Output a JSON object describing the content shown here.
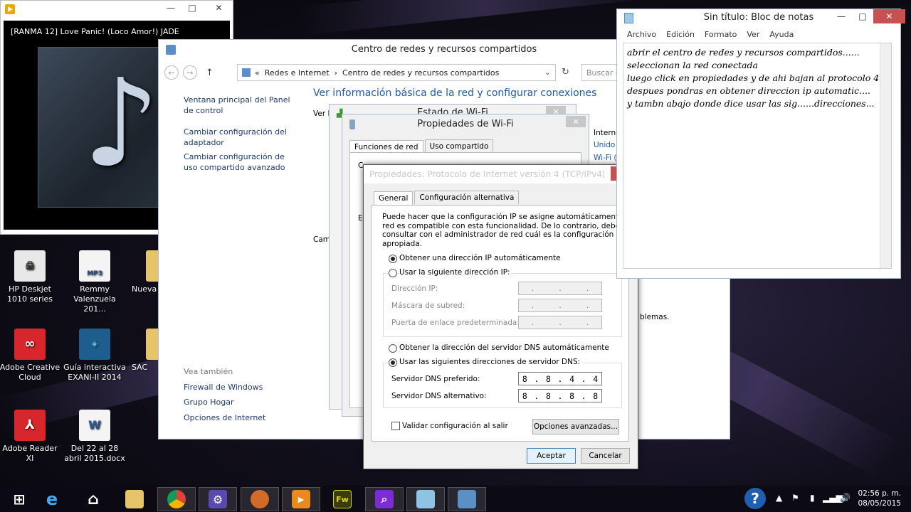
{
  "player": {
    "track": "[RANMA 12]   Love Panic! (Loco Amor!)   JADE"
  },
  "desktop_icons": [
    {
      "label": "HP Deskjet 1010 series",
      "icon": "printer-icon"
    },
    {
      "label": "Remmy Valenzuela 201...",
      "icon": "mp3-file-icon",
      "badge": "MP3"
    },
    {
      "label": "Nueva",
      "icon": "folder-icon"
    },
    {
      "label": "Adobe Creative Cloud",
      "icon": "creative-cloud-icon"
    },
    {
      "label": "Guía interactiva EXANI-II 2014",
      "icon": "exani-icon"
    },
    {
      "label": "SAC",
      "icon": "folder-icon"
    },
    {
      "label": "Adobe Reader XI",
      "icon": "adobe-reader-icon"
    },
    {
      "label": "Del 22 al 28 abril 2015.docx",
      "icon": "word-doc-icon",
      "badge": "W"
    }
  ],
  "network_window": {
    "title": "Centro de redes y recursos compartidos",
    "address": {
      "prefix": "«",
      "crumb1": "Redes e Internet",
      "sep": "›",
      "crumb2": "Centro de redes y recursos compartidos",
      "search_placeholder": "Buscar en"
    },
    "left_links": [
      "Ventana principal del Panel de control",
      "Cambiar configuración del adaptador",
      "Cambiar configuración de uso compartido avanzado"
    ],
    "see_also_label": "Vea también",
    "see_also": [
      "Firewall de Windows",
      "Grupo Hogar",
      "Opciones de Internet"
    ],
    "heading": "Ver información básica de la red y configurar conexiones",
    "partial_texts": {
      "ver": "Ver l",
      "internet": "Interne",
      "unido": "Unido",
      "wifi": "Wi-Fi (",
      "cam": "Cam",
      "problemas": "blemas."
    }
  },
  "notepad": {
    "title": "Sin título: Bloc de notas",
    "menu": [
      "Archivo",
      "Edición",
      "Formato",
      "Ver",
      "Ayuda"
    ],
    "lines": [
      "abrir el centro de redes y recursos compartidos......",
      "   seleccionan la red conectada",
      "luego click en propiedades y de ahi bajan al protocolo 4",
      "despues pondras en obtener direccion ip automatic....",
      "y tambn abajo donde dice usar las sig......direcciones..."
    ]
  },
  "wifi_status": {
    "title": "Estado de Wi-Fi"
  },
  "wifi_props": {
    "title": "Propiedades de Wi-Fi",
    "tabs": [
      "Funciones de red",
      "Uso compartido"
    ],
    "partial": {
      "co": "C",
      "e": "E"
    }
  },
  "tcp_dialog": {
    "title": "Propiedades: Protocolo de Internet versión 4 (TCP/IPv4)",
    "tabs": [
      "General",
      "Configuración alternativa"
    ],
    "description": [
      "Puede hacer que la configuración IP se asigne automáticamente si la",
      "red es compatible con esta funcionalidad. De lo contrario, deberá",
      "consultar con el administrador de red cuál es la configuración IP",
      "apropiada."
    ],
    "ip_auto": "Obtener una dirección IP automáticamente",
    "ip_manual": "Usar la siguiente dirección IP:",
    "ip_label": "Dirección IP:",
    "mask_label": "Máscara de subred:",
    "gateway_label": "Puerta de enlace predeterminada:",
    "dns_auto": "Obtener la dirección del servidor DNS automáticamente",
    "dns_manual": "Usar las siguientes direcciones de servidor DNS:",
    "dns_pref_label": "Servidor DNS preferido:",
    "dns_alt_label": "Servidor DNS alternativo:",
    "dns_pref": [
      "8",
      "8",
      "4",
      "4"
    ],
    "dns_alt": [
      "8",
      "8",
      "8",
      "8"
    ],
    "validate": "Validar configuración al salir",
    "advanced": "Opciones avanzadas...",
    "ok": "Aceptar",
    "cancel": "Cancelar",
    "selected_ip_option": "auto",
    "selected_dns_option": "manual",
    "validate_checked": false
  },
  "taskbar": {
    "time": "02:56 p. m.",
    "date": "08/05/2015",
    "apps": [
      "start-icon",
      "internet-explorer-icon",
      "store-icon",
      "file-explorer-icon",
      "chrome-icon",
      "settings-icon",
      "app-icon",
      "media-player-icon",
      "fireworks-icon",
      "search-app-icon",
      "notepad-icon",
      "network-center-icon"
    ]
  }
}
